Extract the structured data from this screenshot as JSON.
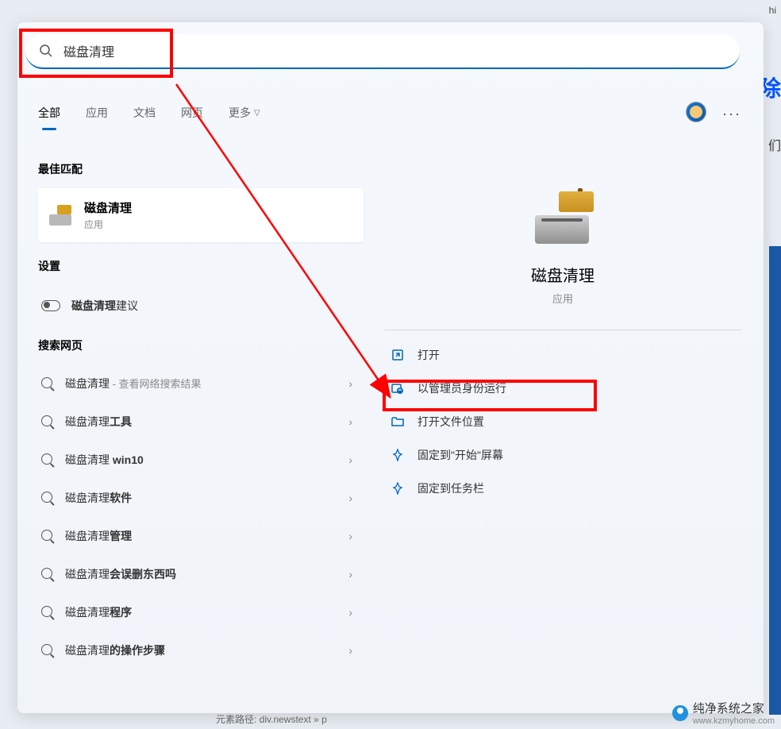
{
  "search": {
    "value": "磁盘清理"
  },
  "tabs": {
    "all": "全部",
    "apps": "应用",
    "docs": "文档",
    "web": "网页",
    "more": "更多"
  },
  "sections": {
    "bestMatch": "最佳匹配",
    "settings": "设置",
    "searchWeb": "搜索网页"
  },
  "bestMatch": {
    "title": "磁盘清理",
    "subtitle": "应用"
  },
  "settings": {
    "item1": {
      "bold": "磁盘清理",
      "normal": "建议"
    }
  },
  "webItems": [
    {
      "normal": "磁盘清理",
      "bold": "",
      "hint": " - 查看网络搜索结果"
    },
    {
      "normal": "磁盘清理",
      "bold": "工具",
      "hint": ""
    },
    {
      "normal": "磁盘清理 ",
      "bold": "win10",
      "hint": ""
    },
    {
      "normal": "磁盘清理",
      "bold": "软件",
      "hint": ""
    },
    {
      "normal": "磁盘清理",
      "bold": "管理",
      "hint": ""
    },
    {
      "normal": "磁盘清理",
      "bold": "会误删东西吗",
      "hint": ""
    },
    {
      "normal": "磁盘清理",
      "bold": "程序",
      "hint": ""
    },
    {
      "normal": "磁盘清理",
      "bold": "的操作步骤",
      "hint": ""
    }
  ],
  "detail": {
    "title": "磁盘清理",
    "subtitle": "应用"
  },
  "actions": {
    "open": "打开",
    "runAsAdmin": "以管理员身份运行",
    "openFileLocation": "打开文件位置",
    "pinToStart": "固定到\"开始\"屏幕",
    "pinToTaskbar": "固定到任务栏"
  },
  "watermark": {
    "name": "纯净系统之家",
    "url": "www.kzmyhome.com"
  },
  "background": {
    "text1": "除",
    "text2": "们",
    "topRight": "hi",
    "bottom": "元素路径: div.newstext » p"
  }
}
